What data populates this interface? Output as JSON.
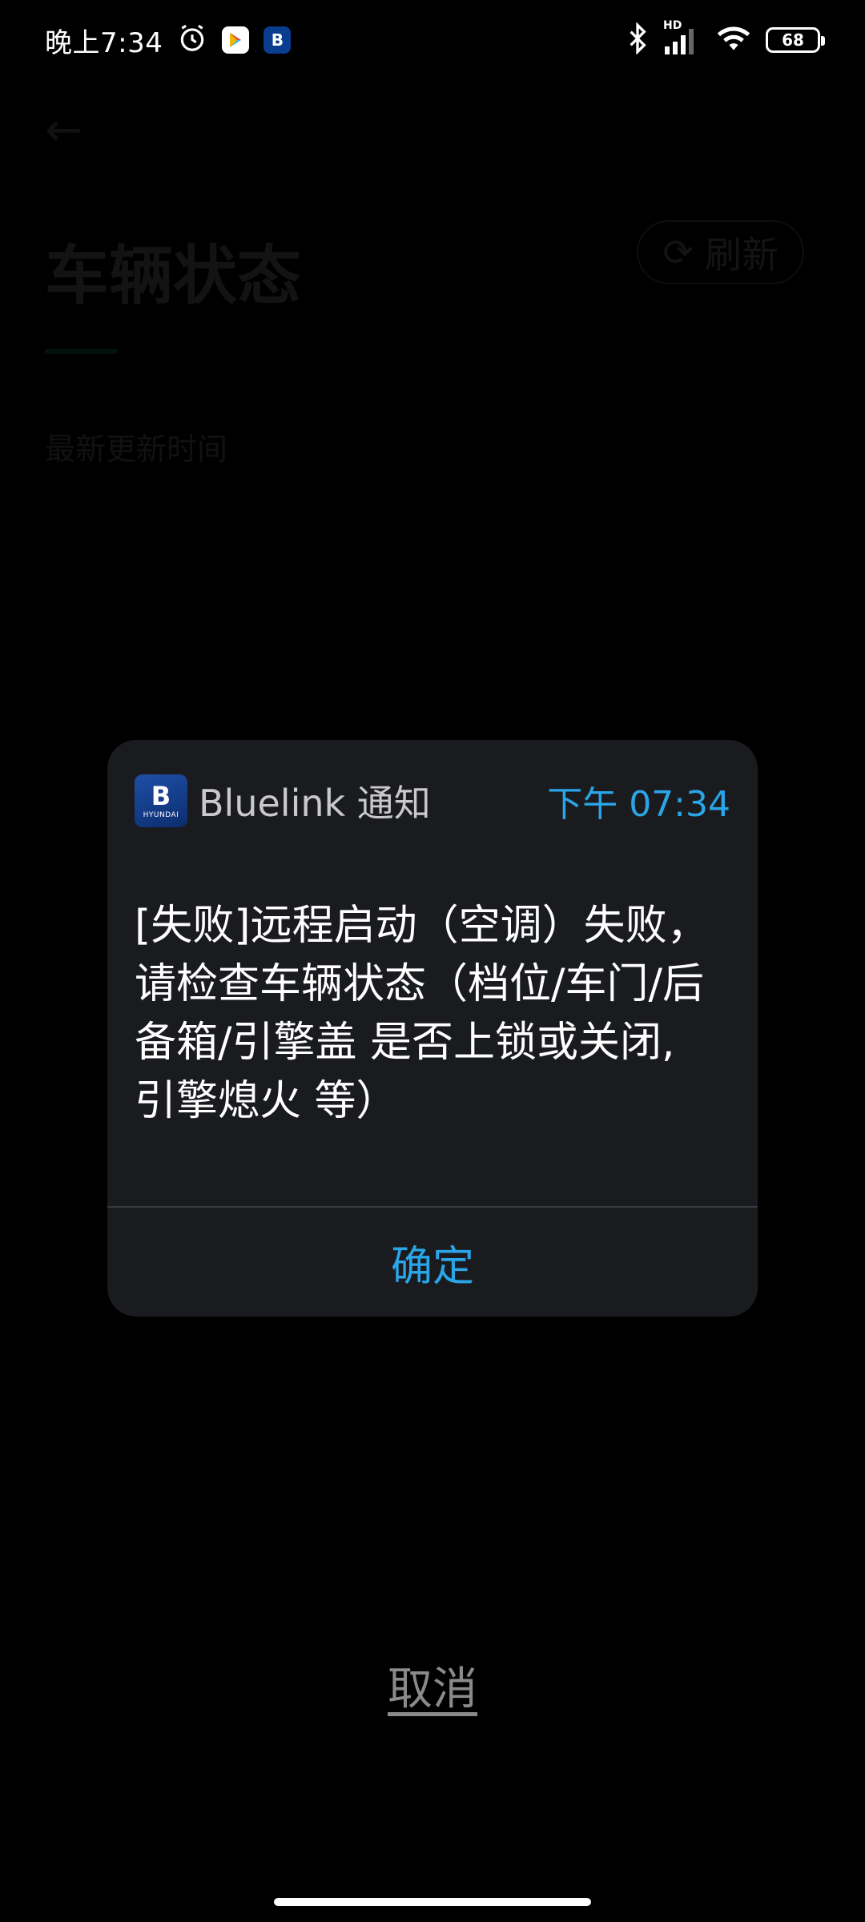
{
  "status_bar": {
    "time": "晚上7:34",
    "battery": "68",
    "network_label": "HD"
  },
  "background_page": {
    "back_icon": "←",
    "title": "车辆状态",
    "refresh_label": "刷新",
    "refresh_icon": "⟳",
    "update_label": "最新更新时间"
  },
  "dialog": {
    "app_logo_letter": "B",
    "app_logo_brand": "HYUNDAI",
    "app_name": "Bluelink 通知",
    "time": "下午 07:34",
    "message": "[失败]远程启动（空调）失败，请检查车辆状态（档位/车门/后备箱/引擎盖 是否上锁或关闭,引擎熄火 等）",
    "confirm_label": "确定"
  },
  "cancel_label": "取消",
  "colors": {
    "accent": "#2aa6e8",
    "dialog_bg": "#1a1b1f",
    "cancel_text": "#8a8a8a"
  }
}
